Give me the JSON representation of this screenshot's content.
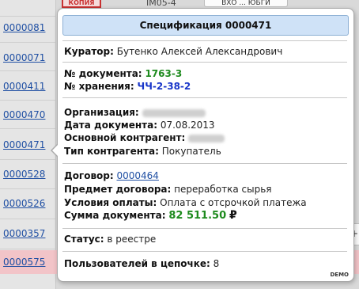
{
  "background": {
    "stamp": "КОПИЯ",
    "top_number": "IM05-4",
    "top_button": "ВХО ... ЮБГИ",
    "rows": [
      {
        "id": "0000081"
      },
      {
        "id": "0000071"
      },
      {
        "id": "0000411"
      },
      {
        "id": "0000470"
      },
      {
        "id": "0000471"
      },
      {
        "id": "0000528"
      },
      {
        "id": "0000526"
      },
      {
        "id": "0000357"
      },
      {
        "id": "0000575"
      }
    ],
    "right_control": "+"
  },
  "tooltip": {
    "title": "Спецификация 0000471",
    "curator_label": "Куратор:",
    "curator_value": "Бутенко Алексей Александрович",
    "doc_number_label": "№ документа:",
    "doc_number_value": "1763-3",
    "storage_label": "№ хранения:",
    "storage_value": "ЧЧ-2-38-2",
    "org_label": "Организация:",
    "date_label": "Дата документа:",
    "date_value": "07.08.2013",
    "counterparty_label": "Основной контрагент:",
    "counterparty_type_label": "Тип контрагента:",
    "counterparty_type_value": "Покупатель",
    "contract_label": "Договор:",
    "contract_value": "0000464",
    "subject_label": "Предмет договора:",
    "subject_value": "переработка сырья",
    "payment_label": "Условия оплаты:",
    "payment_value": "Оплата с отсрочкой платежа",
    "amount_label": "Сумма документа:",
    "amount_value": "82 511.50",
    "currency_symbol": "₽",
    "status_label": "Статус:",
    "status_value": "в реестре",
    "users_label": "Пользователей в цепочке:",
    "users_value": "8",
    "demo": "DEMO"
  }
}
